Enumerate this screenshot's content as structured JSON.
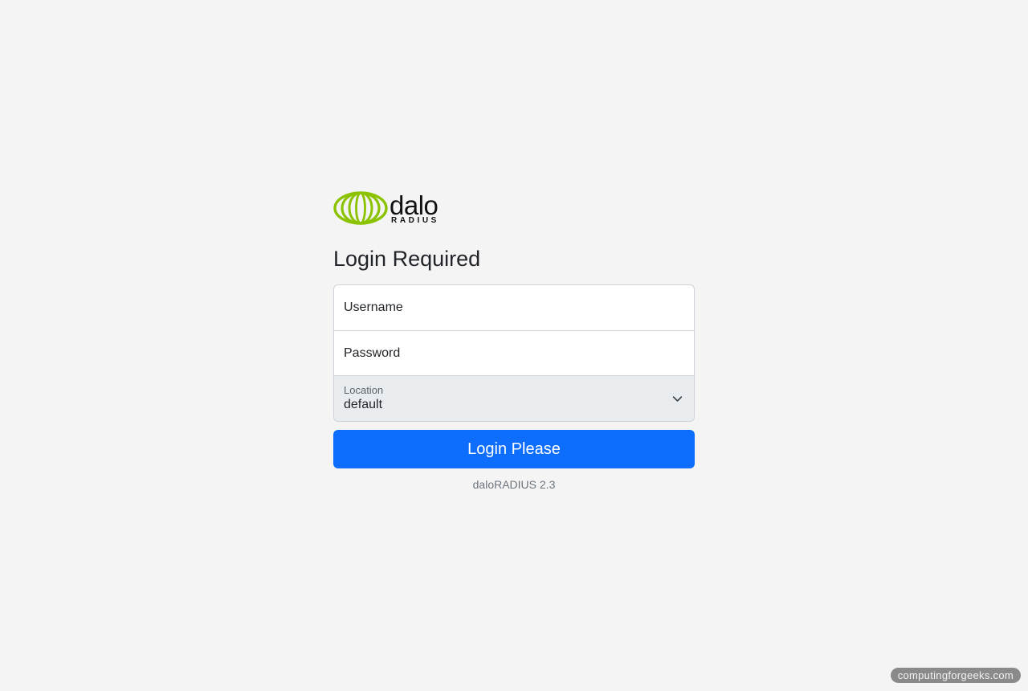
{
  "logo": {
    "word": "dalo",
    "sub": "RADIUS",
    "mark_color": "#8cc300"
  },
  "title": "Login Required",
  "form": {
    "username_placeholder": "Username",
    "password_placeholder": "Password",
    "location": {
      "label": "Location",
      "selected": "default"
    },
    "submit_label": "Login Please"
  },
  "footer": {
    "version": "daloRADIUS 2.3"
  },
  "watermark": "computingforgeeks.com",
  "colors": {
    "primary": "#0d6efd",
    "background": "#f4f4f4"
  },
  "icons": {
    "select_chevron": "chevron-down-icon"
  }
}
